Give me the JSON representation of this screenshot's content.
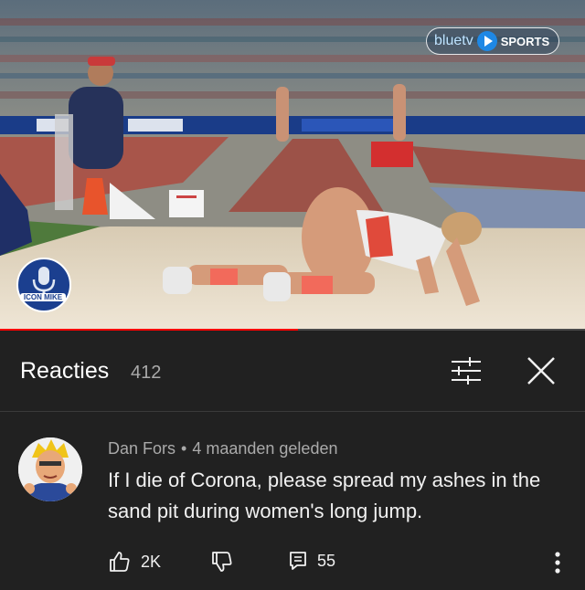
{
  "video": {
    "watermark_brand": "bluetv",
    "watermark_sports": "SPORTS",
    "channel_logo_text": "ICON MIKE",
    "progress_fraction": 0.51
  },
  "reactions": {
    "title": "Reacties",
    "count": "412",
    "filter_icon": "sliders-icon",
    "close_icon": "close-icon"
  },
  "comment": {
    "author": "Dan Fors",
    "separator": "•",
    "time": "4 maanden geleden",
    "text": "If I die of Corona, please spread my ashes in the sand pit during women's long jump.",
    "likes": "2K",
    "replies": "55",
    "icons": {
      "like": "thumb-up-icon",
      "dislike": "thumb-down-icon",
      "reply": "reply-icon",
      "more": "more-vert-icon"
    }
  },
  "colors": {
    "background": "#212121",
    "progress": "#ff0000",
    "secondary_text": "#aaaaaa",
    "primary_text": "#f1f1f1"
  }
}
